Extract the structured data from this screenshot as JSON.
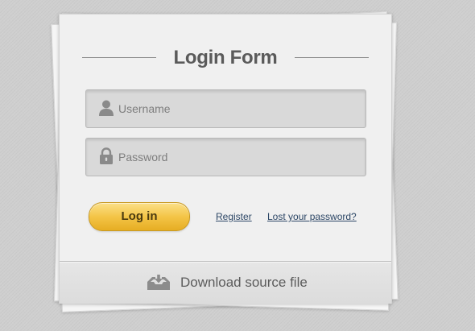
{
  "form": {
    "title": "Login Form"
  },
  "username": {
    "placeholder": "Username",
    "icon": "user-icon"
  },
  "password": {
    "placeholder": "Password",
    "icon": "lock-icon"
  },
  "actions": {
    "login_label": "Log in",
    "register_label": "Register",
    "lost_password_label": "Lost your password?"
  },
  "footer": {
    "download_label": "Download source file",
    "icon": "download-tray-icon"
  },
  "colors": {
    "login_button": "#f4c547",
    "link": "#2d4766",
    "background": "#cfcfcf"
  }
}
